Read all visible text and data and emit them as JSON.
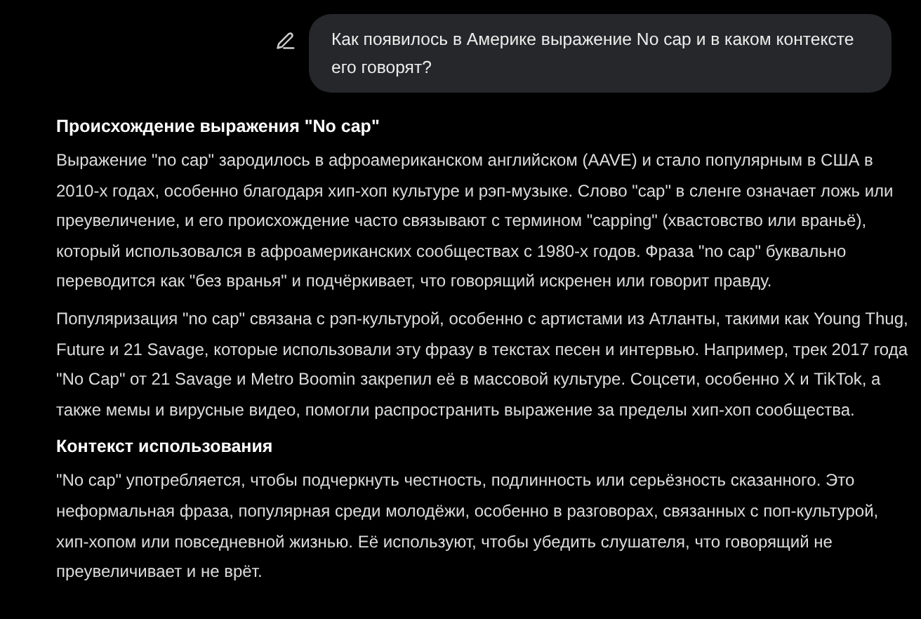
{
  "user_message": {
    "text": "Как появилось в Америке выражение No cap и в каком контексте его говорят?"
  },
  "response": [
    {
      "kind": "heading",
      "text": "Происхождение выражения \"No cap\""
    },
    {
      "kind": "paragraph",
      "text": "Выражение \"no cap\" зародилось в афроамериканском английском (AAVE) и стало популярным в США в 2010-х годах, особенно благодаря хип-хоп культуре и рэп-музыке. Слово \"cap\" в сленге означает ложь или преувеличение, и его происхождение часто связывают с термином \"capping\" (хвастовство или враньё), который использовался в афроамериканских сообществах с 1980-х годов. Фраза \"no cap\" буквально переводится как \"без вранья\" и подчёркивает, что говорящий искренен или говорит правду."
    },
    {
      "kind": "paragraph",
      "text": "Популяризация \"no cap\" связана с рэп-культурой, особенно с артистами из Атланты, такими как Young Thug, Future и 21 Savage, которые использовали эту фразу в текстах песен и интервью. Например, трек 2017 года \"No Cap\" от 21 Savage и Metro Boomin закрепил её в массовой культуре. Соцсети, особенно X и TikTok, а также мемы и вирусные видео, помогли распространить выражение за пределы хип-хоп сообщества."
    },
    {
      "kind": "heading",
      "text": "Контекст использования"
    },
    {
      "kind": "paragraph",
      "text": "\"No cap\" употребляется, чтобы подчеркнуть честность, подлинность или серьёзность сказанного. Это неформальная фраза, популярная среди молодёжи, особенно в разговорах, связанных с поп-культурой, хип-хопом или повседневной жизнью. Её используют, чтобы убедить слушателя, что говорящий не преувеличивает и не врёт."
    }
  ]
}
